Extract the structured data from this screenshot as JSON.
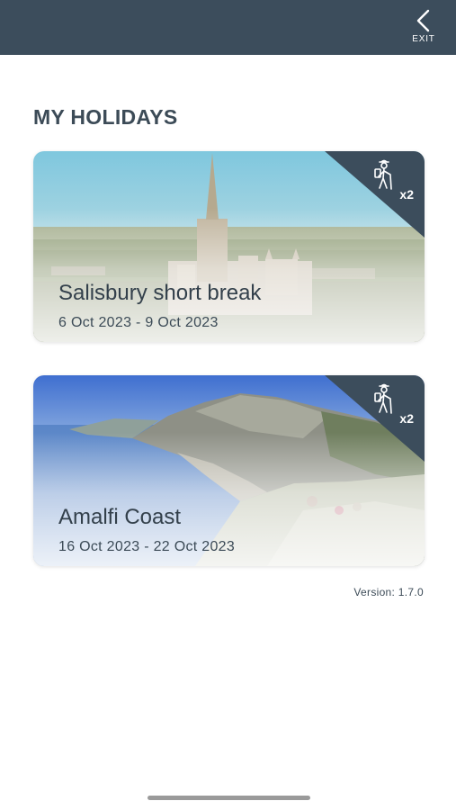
{
  "header": {
    "exit_label": "EXIT",
    "background": "#3c4d5c",
    "back_icon": "chevron-left-icon"
  },
  "page_title": "MY HOLIDAYS",
  "holidays": [
    {
      "title": "Salisbury short break",
      "dates": "6 Oct 2023 - 9 Oct 2023",
      "travellers_badge": "x2",
      "badge_icon": "hiker-icon",
      "image": "salisbury-cathedral-photo"
    },
    {
      "title": "Amalfi Coast",
      "dates": "16 Oct 2023 - 22 Oct 2023",
      "travellers_badge": "x2",
      "badge_icon": "hiker-icon",
      "image": "amalfi-coast-photo"
    }
  ],
  "version_text": "Version: 1.7.0",
  "colors": {
    "accent_dark": "#3c4d5c",
    "text": "#3c4b57"
  }
}
